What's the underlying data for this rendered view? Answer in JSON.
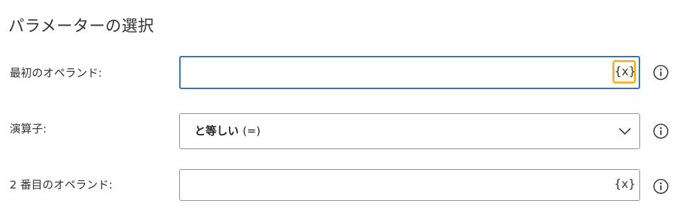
{
  "section": {
    "title": "パラメーターの選択"
  },
  "fields": {
    "first_operand": {
      "label": "最初のオペランド:",
      "value": "",
      "var_button": "{x}",
      "info_icon": "info-icon"
    },
    "operator": {
      "label": "演算子:",
      "selected_text": "と等しい",
      "selected_symbol": "(=)",
      "dropdown_icon": "chevron-down-icon",
      "info_icon": "info-icon"
    },
    "second_operand": {
      "label": "2 番目のオペランド:",
      "value": "",
      "var_button": "{x}",
      "info_icon": "info-icon"
    }
  },
  "colors": {
    "focus_border": "#2f6fbf",
    "highlight": "#f2b632",
    "border": "#8a8a8a"
  }
}
